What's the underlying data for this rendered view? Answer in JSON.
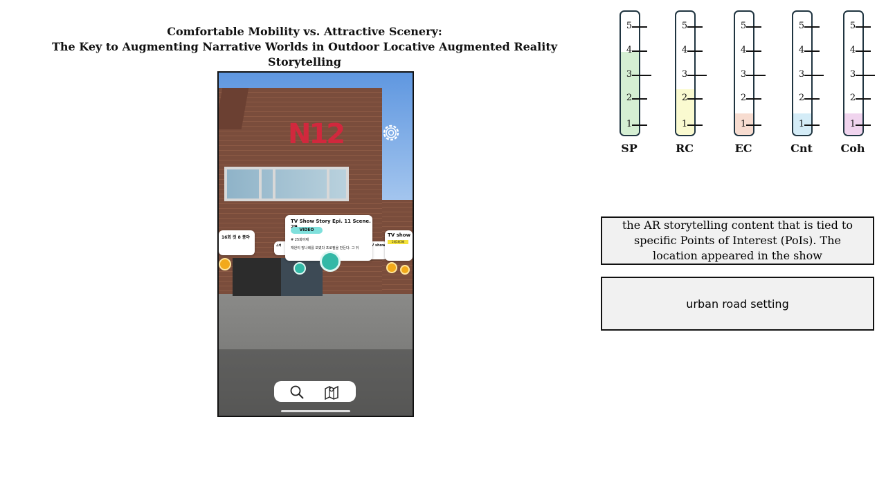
{
  "title": {
    "line1": "Comfortable Mobility vs. Attractive Scenery:",
    "line2": "The Key to Augmenting Narrative Worlds in Outdoor Locative Augmented Reality Storytelling"
  },
  "phone": {
    "logo_text": "N12",
    "cards": {
      "main": {
        "title": "TV Show Story Epi. 11 Scene. 29",
        "badge": "VIDEO",
        "tag": "# 25희야제",
        "desc": "재완이 망나레를 보였다 프로필을 만든다. 그 뒤"
      },
      "left": {
        "title": "16회 컷 8 풍야"
      },
      "right": {
        "title": "TV show",
        "badge": "1회1회3회"
      },
      "mini": {
        "title": "소백"
      },
      "mini2": {
        "title": "TV show"
      }
    },
    "toolbar": {
      "search_icon": "search-icon",
      "map_icon": "map-icon"
    }
  },
  "scales": [
    {
      "label": "SP",
      "level": 3.5,
      "color": "#d5efd3"
    },
    {
      "label": "RC",
      "level": 2,
      "color": "#fafad0"
    },
    {
      "label": "EC",
      "level": 1,
      "color": "#f7dcd0"
    },
    {
      "label": "Cnt",
      "level": 1,
      "color": "#d4ecf7"
    },
    {
      "label": "Coh",
      "level": 1,
      "color": "#f0d4ee"
    }
  ],
  "scale_numbers": [
    "5",
    "4",
    "3",
    "2",
    "1"
  ],
  "boxes": {
    "poi": "the AR storytelling content that is tied to specific Points of Interest (PoIs). The location appeared in the show",
    "setting": "urban road setting"
  }
}
